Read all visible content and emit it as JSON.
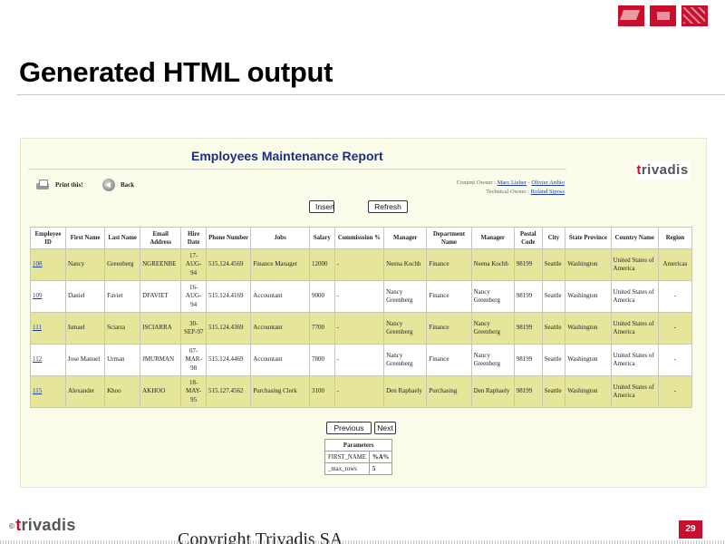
{
  "slide": {
    "title": "Generated HTML output",
    "copyright": "Copyright Trivadis SA",
    "page_number": "29",
    "footer_logo": {
      "prefix": "©",
      "accent": "t",
      "rest": "rivadis"
    }
  },
  "report": {
    "title": "Employees Maintenance Report",
    "logo": {
      "accent": "t",
      "rest": "rivadis"
    },
    "toolbar": {
      "print_label": "Print this!",
      "back_label": "Back"
    },
    "owners": {
      "content_label": "Content Owner :",
      "content_owner_1": "Marc Lieber",
      "separator": "-",
      "content_owner_2": "Olivier Arthio",
      "technical_label": "Technical Owner :",
      "technical_owner": "Roland Siposs"
    },
    "buttons": {
      "insert": "Insert",
      "refresh": "Refresh",
      "previous": "Previous",
      "next": "Next"
    },
    "table": {
      "headers": [
        "Employee ID",
        "First Name",
        "Last Name",
        "Email Address",
        "Hire Date",
        "Phone Number",
        "Jobs",
        "Salary",
        "Commisssion %",
        "Manager",
        "Department Name",
        "Manager",
        "Postal Code",
        "City",
        "State Province",
        "Country Name",
        "Region"
      ],
      "rows": [
        [
          "108",
          "Nancy",
          "Greenberg",
          "NGREENBE",
          "17-AUG-94",
          "515.124.4569",
          "Finance Manager",
          "12000",
          "-",
          "Neena Kochh",
          "Finance",
          "Neena Kochh",
          "98199",
          "Seattle",
          "Washington",
          "United States of America",
          "Americas"
        ],
        [
          "109",
          "Daniel",
          "Faviet",
          "DFAVIET",
          "16-AUG-94",
          "515.124.4169",
          "Accountant",
          "9000",
          "-",
          "Nancy Greenberg",
          "Finance",
          "Nancy Greenberg",
          "98199",
          "Seattle",
          "Washington",
          "United States of America",
          "-"
        ],
        [
          "111",
          "Ismael",
          "Sciarra",
          "ISCIARRA",
          "30-SEP-97",
          "515.124.4369",
          "Accountant",
          "7700",
          "-",
          "Nancy Greenberg",
          "Finance",
          "Nancy Greenberg",
          "98199",
          "Seattle",
          "Washington",
          "United States of America",
          "-"
        ],
        [
          "112",
          "Jose Manuel",
          "Urman",
          "JMURMAN",
          "07-MAR-98",
          "515.124.4469",
          "Accountant",
          "7800",
          "-",
          "Nancy Greenberg",
          "Finance",
          "Nancy Greenberg",
          "98199",
          "Seattle",
          "Washington",
          "United States of America",
          "-"
        ],
        [
          "115",
          "Alexander",
          "Khoo",
          "AKHOO",
          "18-MAY-95",
          "515.127.4562",
          "Purchasing Clerk",
          "3100",
          "-",
          "Den Raphaely",
          "Purchasing",
          "Den Raphaely",
          "98199",
          "Seattle",
          "Washington",
          "United States of America",
          "-"
        ]
      ]
    },
    "parameters": {
      "header": "Parameters",
      "rows": [
        {
          "name": "FIRST_NAME",
          "value": "%A%"
        },
        {
          "name": "_max_rows",
          "value": "5"
        }
      ]
    }
  },
  "colors": {
    "brand_red": "#c8102e",
    "report_title": "#1c2f7a",
    "row_highlight": "#e6e69b",
    "link": "#1a3d9e"
  }
}
